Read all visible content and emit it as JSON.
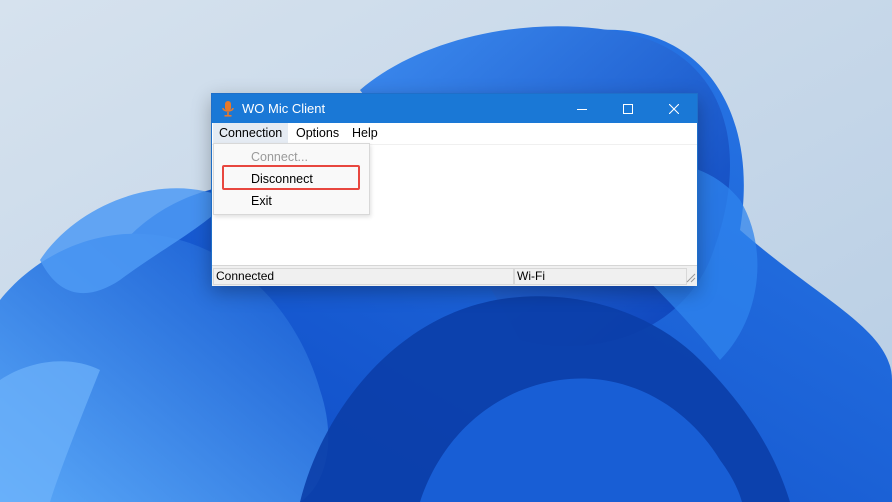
{
  "window": {
    "title": "WO Mic Client",
    "icon": "microphone-icon",
    "controls": [
      "minimize-icon",
      "maximize-icon",
      "close-icon"
    ]
  },
  "menubar": {
    "connection": "Connection",
    "options": "Options",
    "help": "Help"
  },
  "connection_menu": {
    "items": [
      {
        "label": "Connect...",
        "enabled": false
      },
      {
        "label": "Disconnect",
        "enabled": true,
        "highlighted": true
      },
      {
        "label": "Exit",
        "enabled": true
      }
    ]
  },
  "statusbar": {
    "status": "Connected",
    "transport": "Wi-Fi"
  },
  "colors": {
    "titlebar": "#1a78d6",
    "highlight_border": "#e8473f",
    "wallpaper_bloom": "#1565d8"
  }
}
